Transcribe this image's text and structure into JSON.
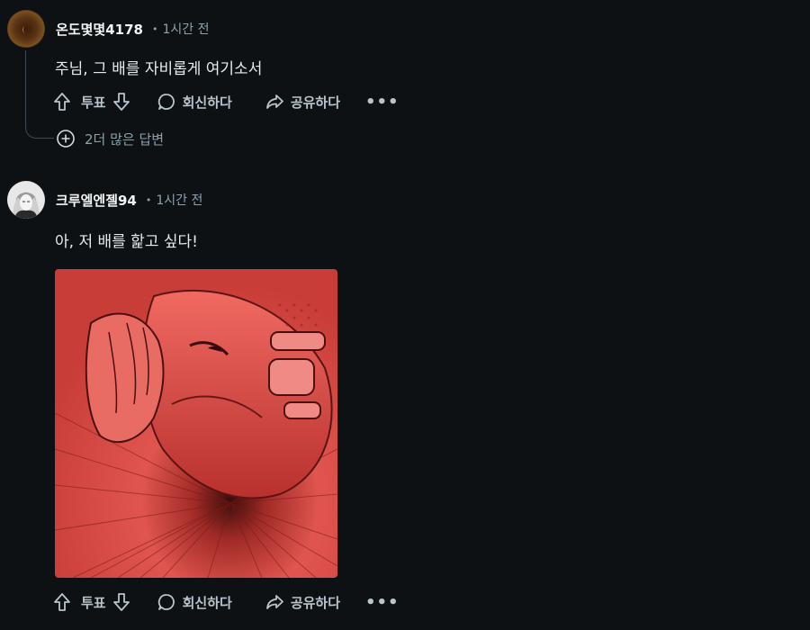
{
  "comments": [
    {
      "username": "온도몇몇4178",
      "separator": "•",
      "time": "1시간 전",
      "body": "주님, 그 배를 자비롭게 여기소서",
      "actions": {
        "vote_label": "투표",
        "reply_label": "회신하다",
        "share_label": "공유하다",
        "more_label": "•••"
      },
      "more_replies": "2더 많은 답변"
    },
    {
      "username": "크루엘엔젤94",
      "separator": "•",
      "time": "1시간 전",
      "body": "아, 저 배를 핥고 싶다!",
      "actions": {
        "vote_label": "투표",
        "reply_label": "회신하다",
        "share_label": "공유하다",
        "more_label": "•••"
      }
    }
  ],
  "colors": {
    "background": "#0e1113",
    "text_primary": "#f2f4f5",
    "text_secondary": "#8ba2ad",
    "image_tint": "#e0554f"
  }
}
